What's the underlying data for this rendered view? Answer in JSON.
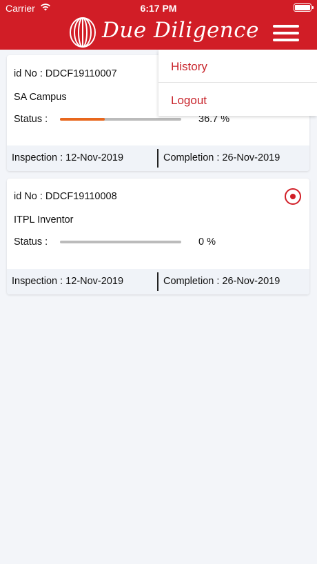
{
  "status_bar": {
    "carrier": "Carrier",
    "time": "6:17 PM"
  },
  "header": {
    "title": "Due Diligence",
    "menu_icon": "hamburger-menu-icon",
    "logo_icon": "jll-logo-icon",
    "accent": "#d11d26"
  },
  "menu": {
    "items": [
      {
        "label": "History"
      },
      {
        "label": "Logout"
      }
    ]
  },
  "cards": [
    {
      "id_text": "id No : DDCF19110007",
      "name": "SA Campus",
      "status_label": "Status :",
      "progress": 0.367,
      "percent_text": "36.7 %",
      "inspection": "Inspection : 12-Nov-2019",
      "completion": "Completion : 26-Nov-2019",
      "selected": false
    },
    {
      "id_text": "id No : DDCF19110008",
      "name": "ITPL Inventor",
      "status_label": "Status :",
      "progress": 0,
      "percent_text": "0 %",
      "inspection": "Inspection : 12-Nov-2019",
      "completion": "Completion : 26-Nov-2019",
      "selected": true
    }
  ]
}
